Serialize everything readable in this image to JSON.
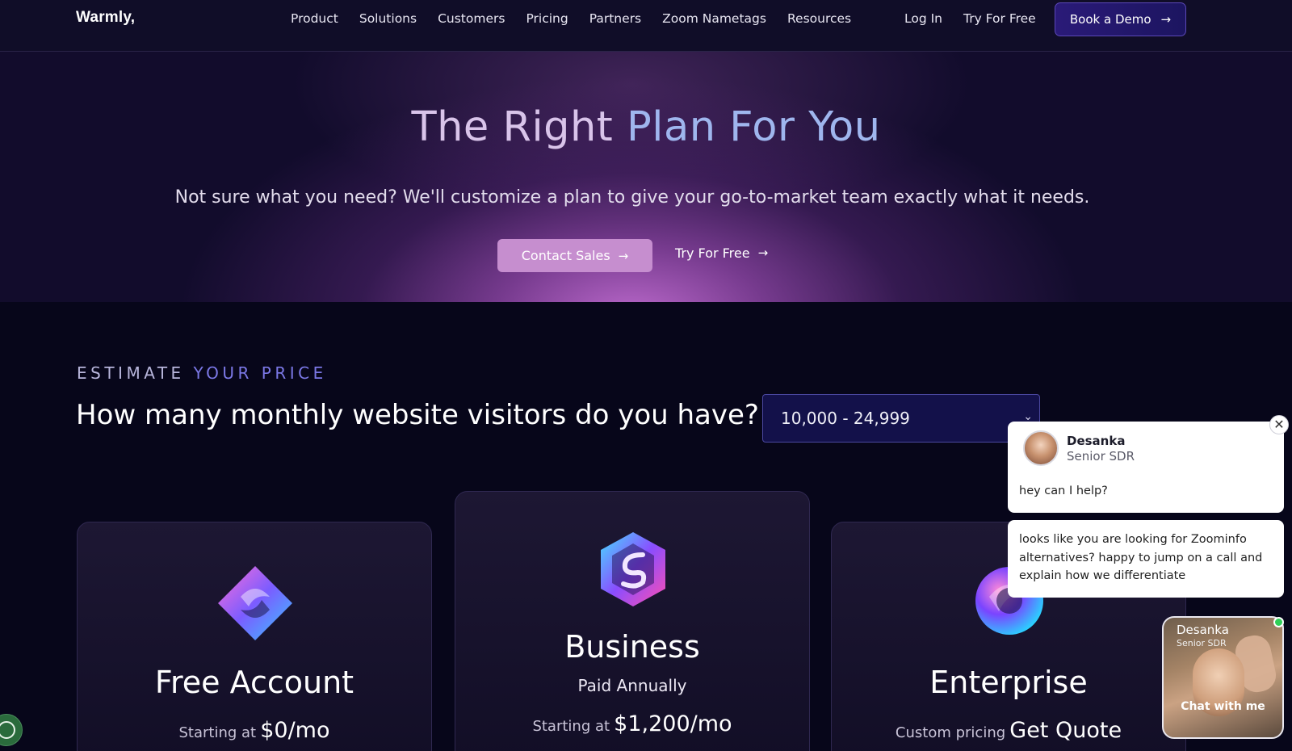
{
  "nav": {
    "logo": "Warmly,",
    "links": [
      "Product",
      "Solutions",
      "Customers",
      "Pricing",
      "Partners",
      "Zoom Nametags",
      "Resources"
    ],
    "login": "Log In",
    "try_free": "Try For Free",
    "book_demo": "Book a Demo"
  },
  "hero": {
    "title_part1": "The Right",
    "title_part2": "Plan For You",
    "subtitle": "Not sure what you need? We'll customize a plan to give your go-to-market team exactly what it needs.",
    "contact_sales": "Contact Sales",
    "try_free": "Try For Free"
  },
  "estimate": {
    "label_part1": "ESTIMATE",
    "label_part2": "YOUR PRICE",
    "question": "How many monthly website visitors do you have?",
    "selected_range": "10,000 - 24,999"
  },
  "plans": [
    {
      "name": "Free Account",
      "price_prefix": "Starting at",
      "price": "$0/mo",
      "icon": "diamond-swirl-icon"
    },
    {
      "name": "Business",
      "billing": "Paid Annually",
      "price_prefix": "Starting at",
      "price": "$1,200/mo",
      "icon": "hexagon-s-icon"
    },
    {
      "name": "Enterprise",
      "price_prefix": "Custom pricing",
      "price": "Get Quote",
      "icon": "orb-swirl-icon"
    }
  ],
  "chat": {
    "agent_name": "Desanka",
    "agent_role": "Senior SDR",
    "message1": "hey can I help?",
    "message2": "looks like you are looking for Zoominfo alternatives? happy to jump on a call and explain how we differentiate",
    "video_name": "Desanka",
    "video_role": "Senior SDR",
    "video_cta": "Chat with me"
  },
  "colors": {
    "background": "#07061a",
    "title_light": "#d9c4ea",
    "title_accent": "#9fb6ee",
    "contact_button": "#c68ecf",
    "estimate_accent": "#7b78e6",
    "online": "#2fcf57"
  }
}
